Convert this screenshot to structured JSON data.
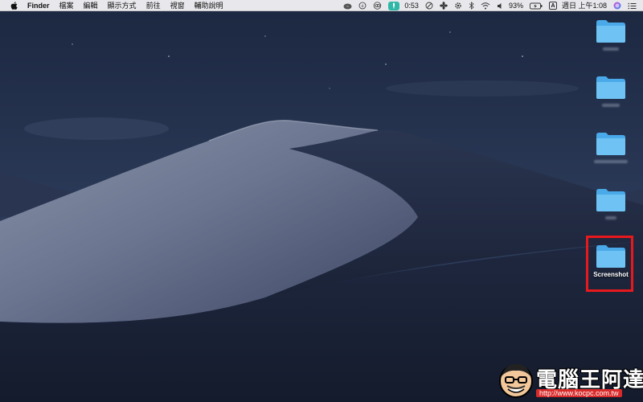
{
  "menubar": {
    "apple_icon": "apple-logo-icon",
    "app_name": "Finder",
    "menus": [
      "檔案",
      "編輯",
      "顯示方式",
      "前往",
      "視窗",
      "輔助說明"
    ],
    "status": {
      "timer": "0:53",
      "battery_percent": "93%",
      "input_method": "A",
      "clock": "週日 上午1:08"
    }
  },
  "desktop": {
    "folders": [
      {
        "label": "",
        "label_blurred": true
      },
      {
        "label": "",
        "label_blurred": true
      },
      {
        "label": "",
        "label_blurred": true
      },
      {
        "label": "",
        "label_blurred": true
      },
      {
        "label": "Screenshot",
        "label_blurred": false,
        "highlighted": true
      }
    ],
    "highlight_color": "#e8191d",
    "folder_color": "#6ec3f4"
  },
  "watermark": {
    "title": "電腦王阿達",
    "url": "http://www.kocpc.com.tw"
  }
}
